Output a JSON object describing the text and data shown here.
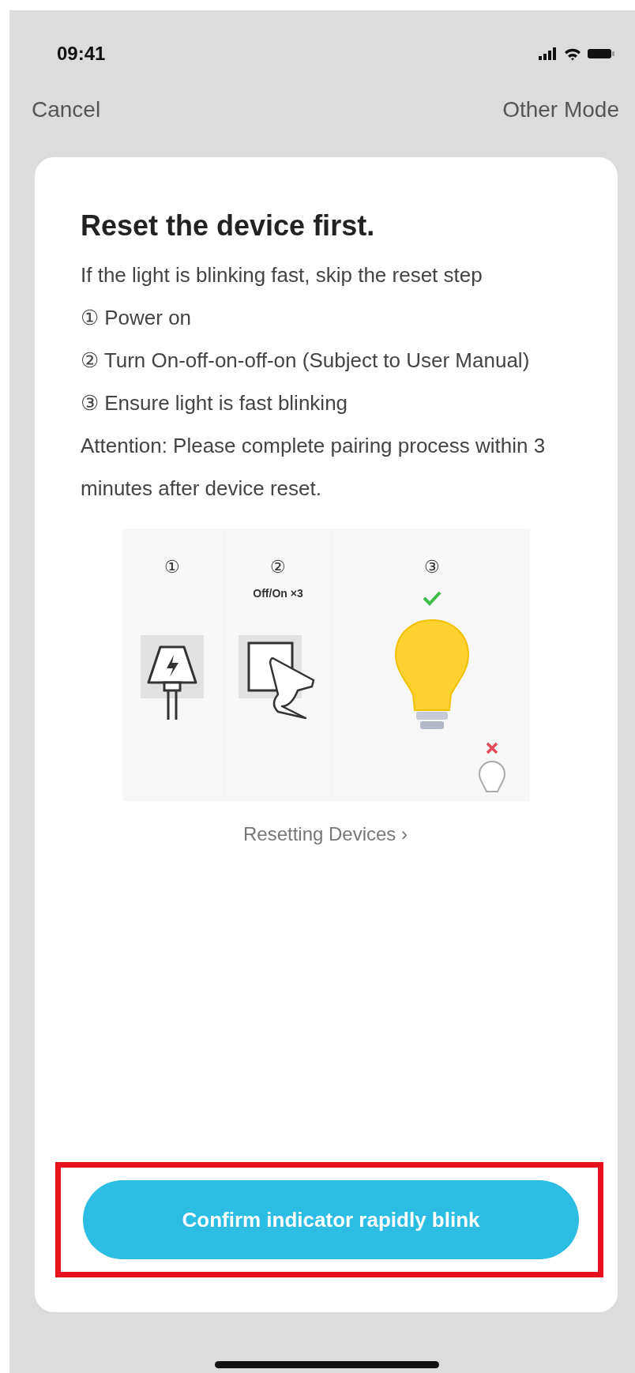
{
  "status_bar": {
    "time": "09:41"
  },
  "nav": {
    "left": "Cancel",
    "right": "Other Mode"
  },
  "card": {
    "title": "Reset the device first.",
    "paragraphs": [
      "If the light is blinking fast, skip the reset step",
      "① Power on",
      "② Turn On-off-on-off-on (Subject to User Manual)",
      "③ Ensure light is fast blinking",
      "Attention: Please complete pairing process within 3 minutes after device reset."
    ],
    "illustration": {
      "steps": [
        {
          "number": "①",
          "kind": "plug"
        },
        {
          "number": "②",
          "caption": "Off/On ×3",
          "kind": "switch"
        },
        {
          "number": "③",
          "kind": "bulb"
        }
      ]
    },
    "link": "Resetting Devices ›",
    "button": {
      "label": "Confirm indicator rapidly blink",
      "highlighted": true
    }
  }
}
